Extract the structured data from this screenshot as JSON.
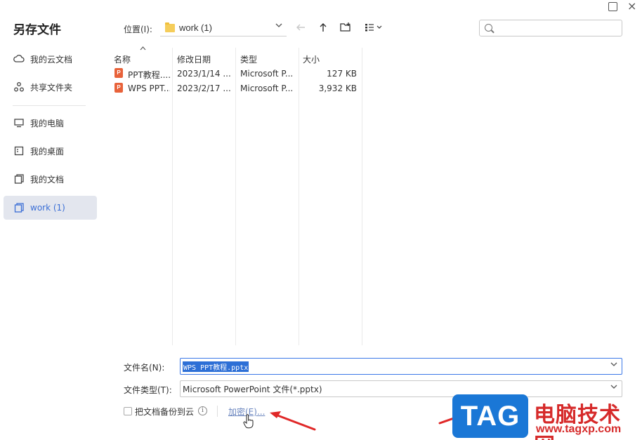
{
  "window": {
    "close_glyph": "×"
  },
  "dialog": {
    "title": "另存文件"
  },
  "sidebar": {
    "items": [
      {
        "label": "我的云文档",
        "icon": "cloud-icon"
      },
      {
        "label": "共享文件夹",
        "icon": "share-icon"
      },
      {
        "label": "我的电脑",
        "icon": "monitor-icon"
      },
      {
        "label": "我的桌面",
        "icon": "desktop-icon"
      },
      {
        "label": "我的文档",
        "icon": "documents-icon"
      },
      {
        "label": "work (1)",
        "icon": "folder-icon",
        "active": true
      }
    ]
  },
  "toolbar": {
    "location_label": "位置(I):",
    "location_value": "work (1)",
    "search_placeholder": ""
  },
  "file_list": {
    "columns": [
      "名称",
      "修改日期",
      "类型",
      "大小"
    ],
    "rows": [
      {
        "name": "PPT教程....",
        "date": "2023/1/14 ...",
        "type": "Microsoft P...",
        "size": "127 KB"
      },
      {
        "name": "WPS PPT....",
        "date": "2023/2/17 ...",
        "type": "Microsoft P...",
        "size": "3,932 KB"
      }
    ]
  },
  "form": {
    "filename_label": "文件名(N):",
    "filename_value": "WPS PPT教程.pptx",
    "filetype_label": "文件类型(T):",
    "filetype_value": "Microsoft PowerPoint 文件(*.pptx)",
    "backup_label": "把文档备份到云",
    "backup_checked": false,
    "encrypt_link": "加密(E)..."
  },
  "watermark": {
    "tag": "TAG",
    "chinese": "电脑技术网",
    "url": "www.tagxp.com"
  },
  "colors": {
    "accent": "#3b6fd6",
    "active_bg": "#e3e6ee",
    "selection": "#2d6fd6",
    "annotation": "#e02828"
  }
}
